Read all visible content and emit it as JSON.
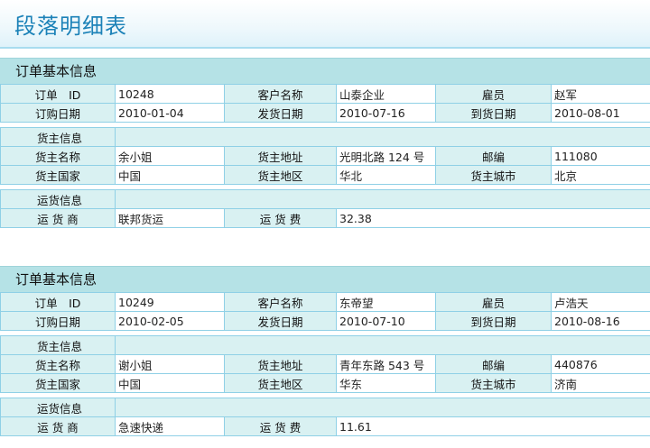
{
  "page": {
    "title": "段落明细表"
  },
  "labels": {
    "section_title": "订单基本信息",
    "order_id": "订单　ID",
    "customer_name": "客户名称",
    "employee": "雇员",
    "order_date": "订购日期",
    "ship_date": "发货日期",
    "arrival_date": "到货日期",
    "shipper_group": "货主信息",
    "shipper_name": "货主名称",
    "shipper_address": "货主地址",
    "postcode": "邮编",
    "shipper_country": "货主国家",
    "shipper_region": "货主地区",
    "shipper_city": "货主城市",
    "shipping_group": "运货信息",
    "carrier": "运 货 商",
    "freight": "运 货 费"
  },
  "orders": [
    {
      "order_id": "10248",
      "customer_name": "山泰企业",
      "employee": "赵军",
      "order_date": "2010-01-04",
      "ship_date": "2010-07-16",
      "arrival_date": "2010-08-01",
      "shipper_name": "余小姐",
      "shipper_address": "光明北路 124 号",
      "postcode": "111080",
      "shipper_country": "中国",
      "shipper_region": "华北",
      "shipper_city": "北京",
      "carrier": "联邦货运",
      "freight": "32.38"
    },
    {
      "order_id": "10249",
      "customer_name": "东帝望",
      "employee": "卢浩天",
      "order_date": "2010-02-05",
      "ship_date": "2010-07-10",
      "arrival_date": "2010-08-16",
      "shipper_name": "谢小姐",
      "shipper_address": "青年东路 543 号",
      "postcode": "440876",
      "shipper_country": "中国",
      "shipper_region": "华东",
      "shipper_city": "济南",
      "carrier": "急速快递",
      "freight": "11.61"
    }
  ]
}
